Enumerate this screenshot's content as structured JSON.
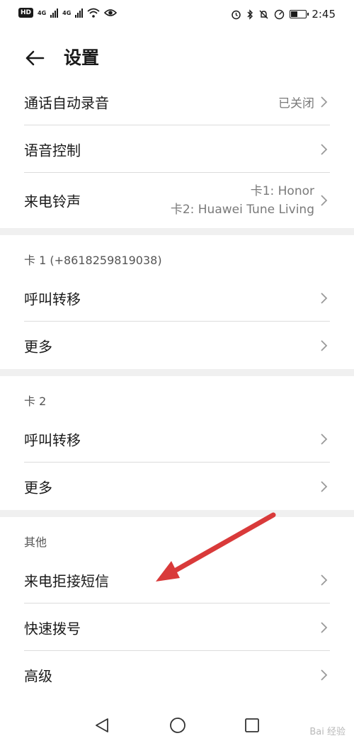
{
  "status": {
    "hd": "HD",
    "net1": "4G",
    "net2": "4G",
    "time": "2:45",
    "battery_percent": 45
  },
  "header": {
    "title": "设置"
  },
  "settings": {
    "record": {
      "label": "通话自动录音",
      "value": "已关闭"
    },
    "voice": {
      "label": "语音控制"
    },
    "ringtone": {
      "label": "来电铃声",
      "value_line1": "卡1: Honor",
      "value_line2": "卡2: Huawei Tune Living"
    }
  },
  "card1": {
    "header": "卡 1 (+8618259819038)",
    "forward": "呼叫转移",
    "more": "更多"
  },
  "card2": {
    "header": "卡 2",
    "forward": "呼叫转移",
    "more": "更多"
  },
  "other": {
    "header": "其他",
    "reject_sms": "来电拒接短信",
    "speed_dial": "快速拨号",
    "advanced": "高级"
  },
  "watermark": "Bai 经验",
  "colors": {
    "annotation_arrow": "#d93a3a",
    "divider": "#dcdcdc",
    "section_gap": "#f0f0f0"
  }
}
